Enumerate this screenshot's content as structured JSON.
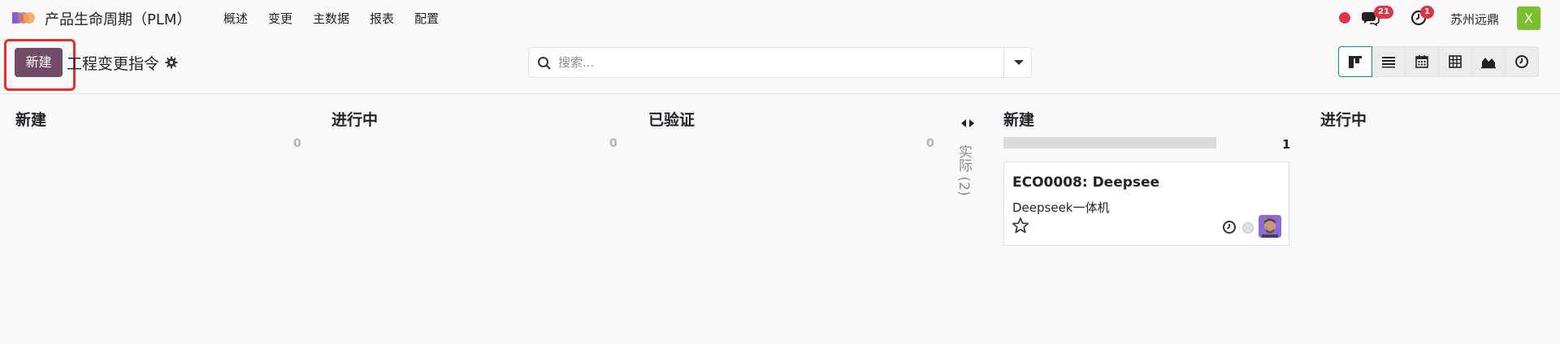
{
  "app": {
    "title": "产品生命周期（PLM）",
    "menu": [
      "概述",
      "变更",
      "主数据",
      "报表",
      "配置"
    ]
  },
  "systray": {
    "chat_badge": "21",
    "activity_badge": "1",
    "company": "苏州远鼎",
    "user_initial": "X"
  },
  "control": {
    "new_button": "新建",
    "breadcrumb": "工程变更指令",
    "search_placeholder": "搜索..."
  },
  "views": [
    "kanban-view-icon",
    "list-view-icon",
    "calendar-view-icon",
    "pivot-view-icon",
    "graph-view-icon",
    "activity-view-icon"
  ],
  "kanban": {
    "left_columns": [
      {
        "title": "新建",
        "count": "0"
      },
      {
        "title": "进行中",
        "count": "0"
      },
      {
        "title": "已验证",
        "count": "0"
      }
    ],
    "folded_column": {
      "label": "实际 (2)"
    },
    "right_columns": [
      {
        "title": "新建",
        "count": "1"
      },
      {
        "title": "进行中"
      }
    ],
    "card": {
      "title": "ECO0008: Deepsee",
      "subtitle": "Deepseek一体机"
    }
  },
  "colors": {
    "primary": "#714b67",
    "badge": "#dc3545",
    "highlight": "#ee2b2b",
    "avatar_bg": "#7cbf2f"
  }
}
